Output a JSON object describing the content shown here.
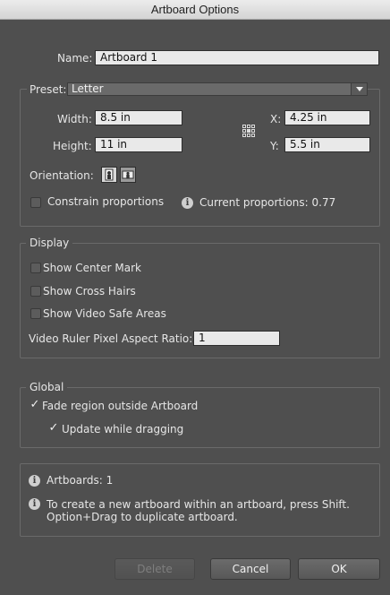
{
  "window": {
    "title": "Artboard Options"
  },
  "name": {
    "label": "Name:",
    "value": "Artboard 1"
  },
  "preset": {
    "label": "Preset:",
    "value": "Letter",
    "width_label": "Width:",
    "width_value": "8.5 in",
    "height_label": "Height:",
    "height_value": "11 in",
    "x_label": "X:",
    "x_value": "4.25 in",
    "y_label": "Y:",
    "y_value": "5.5 in",
    "orientation_label": "Orientation:",
    "orientation_options": [
      "portrait",
      "landscape"
    ],
    "orientation_selected": "portrait",
    "constrain_label": "Constrain proportions",
    "constrain_checked": false,
    "proportions_label": "Current proportions: 0.77"
  },
  "display": {
    "legend": "Display",
    "show_center_mark": {
      "label": "Show Center Mark",
      "checked": false
    },
    "show_cross_hairs": {
      "label": "Show Cross Hairs",
      "checked": false
    },
    "show_video_safe": {
      "label": "Show Video Safe Areas",
      "checked": false
    },
    "video_ratio_label": "Video Ruler Pixel Aspect Ratio:",
    "video_ratio_value": "1"
  },
  "global": {
    "legend": "Global",
    "fade_region": {
      "label": "Fade region outside Artboard",
      "checked": true
    },
    "update_dragging": {
      "label": "Update while dragging",
      "checked": true
    }
  },
  "info": {
    "artboards": "Artboards: 1",
    "tip_line1": "To create a new artboard within an artboard, press Shift.",
    "tip_line2": "Option+Drag to duplicate artboard."
  },
  "buttons": {
    "delete": "Delete",
    "cancel": "Cancel",
    "ok": "OK"
  },
  "colors": {
    "panel_bg": "#4f4f4f",
    "field_bg": "#e9e9e9",
    "border": "#6a6a6a"
  },
  "icons": [
    "info-icon",
    "reference-point-icon",
    "portrait-icon",
    "landscape-icon",
    "checkmark-icon",
    "chevron-down-icon"
  ]
}
